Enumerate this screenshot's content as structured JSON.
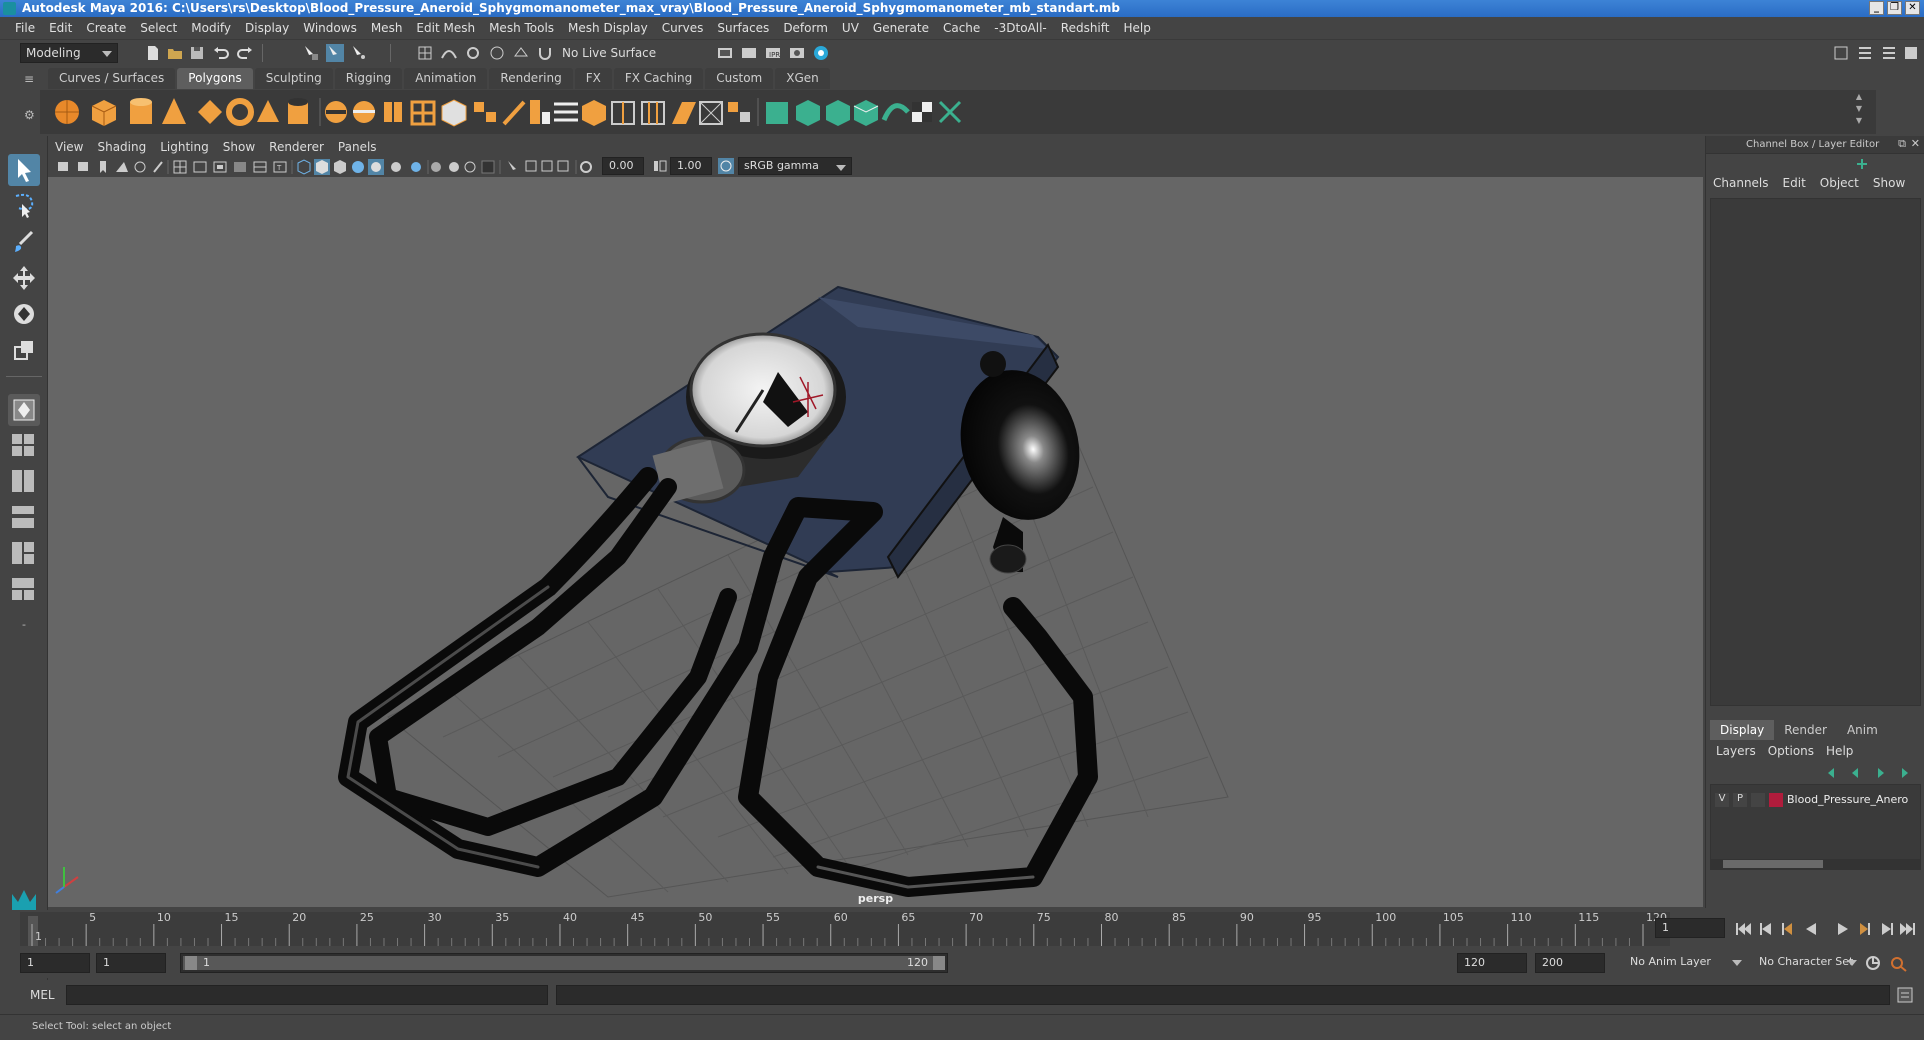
{
  "window": {
    "title": "Autodesk Maya 2016: C:\\Users\\rs\\Desktop\\Blood_Pressure_Aneroid_Sphygmomanometer_max_vray\\Blood_Pressure_Aneroid_Sphygmomanometer_mb_standart.mb",
    "buttons": [
      "_",
      "❐",
      "✕"
    ]
  },
  "menubar": [
    "File",
    "Edit",
    "Create",
    "Select",
    "Modify",
    "Display",
    "Windows",
    "Mesh",
    "Edit Mesh",
    "Mesh Tools",
    "Mesh Display",
    "Curves",
    "Surfaces",
    "Deform",
    "UV",
    "Generate",
    "Cache",
    "-3DtoAll-",
    "Redshift",
    "Help"
  ],
  "statusline": {
    "mode": "Modeling",
    "live_surface": "No Live Surface"
  },
  "shelf": {
    "tabs": [
      "Curves / Surfaces",
      "Polygons",
      "Sculpting",
      "Rigging",
      "Animation",
      "Rendering",
      "FX",
      "FX Caching",
      "Custom",
      "XGen"
    ],
    "active_tab": "Polygons"
  },
  "viewport": {
    "menus": [
      "View",
      "Shading",
      "Lighting",
      "Show",
      "Renderer",
      "Panels"
    ],
    "exposure": "0.00",
    "gamma": "1.00",
    "color_space": "sRGB gamma",
    "camera_label": "persp"
  },
  "channel_box": {
    "title": "Channel Box / Layer Editor",
    "menus": [
      "Channels",
      "Edit",
      "Object",
      "Show"
    ]
  },
  "layer_editor": {
    "tabs": [
      "Display",
      "Render",
      "Anim"
    ],
    "active_tab": "Display",
    "menus": [
      "Layers",
      "Options",
      "Help"
    ],
    "layers": [
      {
        "v": "V",
        "p": "P",
        "color": "#b01c3c",
        "name": "Blood_Pressure_Anero"
      }
    ]
  },
  "timeline": {
    "ticks": [
      "1",
      "5",
      "10",
      "15",
      "20",
      "25",
      "30",
      "35",
      "40",
      "45",
      "50",
      "55",
      "60",
      "65",
      "70",
      "75",
      "80",
      "85",
      "90",
      "95",
      "100",
      "105",
      "110",
      "115",
      "120"
    ],
    "current_frame": "1"
  },
  "range": {
    "start": "1",
    "playback_start": "1",
    "slider_start": "1",
    "slider_end": "120",
    "playback_end": "120",
    "end": "200",
    "anim_layer": "No Anim Layer",
    "character_set": "No Character Set"
  },
  "command": {
    "label": "MEL"
  },
  "help_line": "Select Tool: select an object",
  "colors": {
    "accent": "#5e5e5e",
    "title_blue": "#2a6cc4",
    "layer_red": "#b01c3c"
  }
}
